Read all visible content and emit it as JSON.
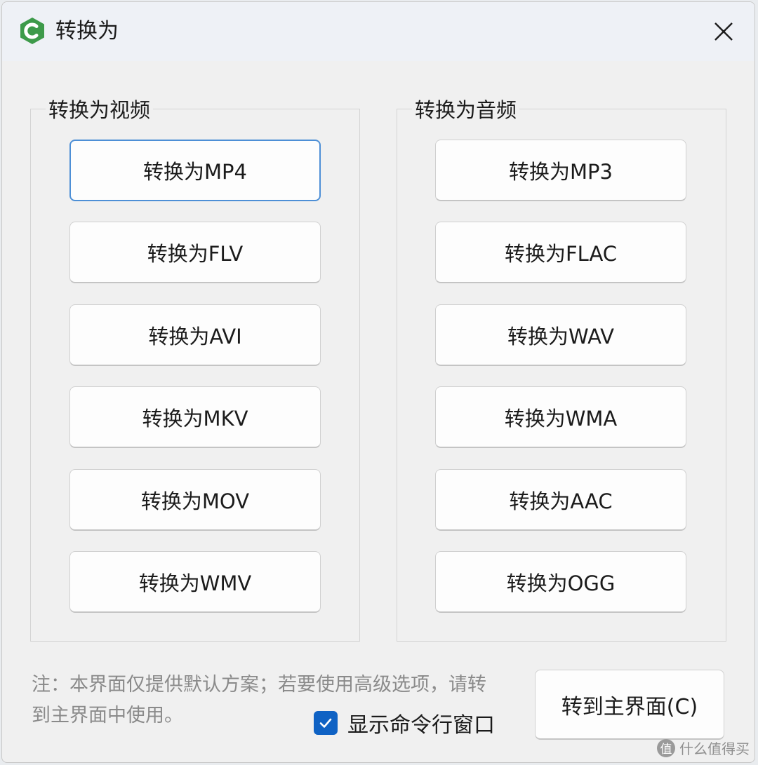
{
  "window": {
    "title": "转换为",
    "icon": "app-logo-icon",
    "close_icon": "close-icon"
  },
  "video_group": {
    "legend": "转换为视频",
    "buttons": [
      "转换为MP4",
      "转换为FLV",
      "转换为AVI",
      "转换为MKV",
      "转换为MOV",
      "转换为WMV"
    ]
  },
  "audio_group": {
    "legend": "转换为音频",
    "buttons": [
      "转换为MP3",
      "转换为FLAC",
      "转换为WAV",
      "转换为WMA",
      "转换为AAC",
      "转换为OGG"
    ]
  },
  "footer": {
    "note": "注：本界面仅提供默认方案；若要使用高级选项，请转到主界面中使用。",
    "show_cmd_label": "显示命令行窗口",
    "show_cmd_checked": true,
    "main_button_label": "转到主界面(C)"
  },
  "watermark": {
    "badge": "值",
    "text": "什么值得买"
  },
  "colors": {
    "accent": "#0f62c4",
    "focus_border": "#4d8fd6",
    "logo_green": "#3d9a4a"
  }
}
